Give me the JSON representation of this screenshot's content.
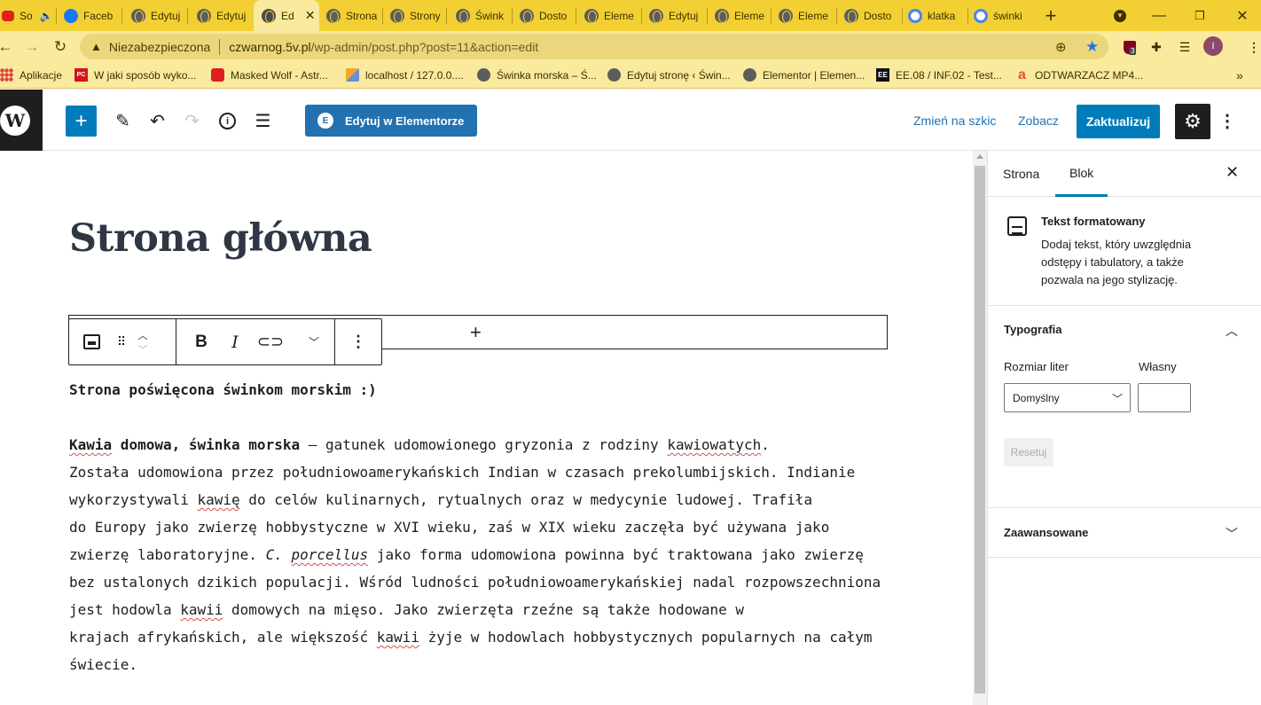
{
  "browser": {
    "tabs": [
      {
        "label": "So",
        "favicon": "youtube-icon"
      },
      {
        "label": "Faceb",
        "favicon": "facebook-icon"
      },
      {
        "label": "Edytuj",
        "favicon": "globe-icon"
      },
      {
        "label": "Edytuj",
        "favicon": "globe-icon"
      },
      {
        "label": "Ed",
        "favicon": "globe-icon",
        "active": true
      },
      {
        "label": "Strona",
        "favicon": "globe-icon"
      },
      {
        "label": "Strony",
        "favicon": "globe-icon"
      },
      {
        "label": "Śwink",
        "favicon": "globe-icon"
      },
      {
        "label": "Dosto",
        "favicon": "globe-icon"
      },
      {
        "label": "Eleme",
        "favicon": "globe-icon"
      },
      {
        "label": "Edytuj",
        "favicon": "globe-icon"
      },
      {
        "label": "Eleme",
        "favicon": "globe-icon"
      },
      {
        "label": "Eleme",
        "favicon": "globe-icon"
      },
      {
        "label": "Dosto",
        "favicon": "globe-icon"
      },
      {
        "label": "klatka",
        "favicon": "google-icon"
      },
      {
        "label": "świnki",
        "favicon": "google-icon"
      }
    ],
    "security_label": "Niezabezpieczona",
    "url_host": "czwarnog.5v.pl",
    "url_path": "/wp-admin/post.php?post=11&action=edit",
    "extension_badge": "3",
    "profile_initial": "I",
    "bookmarks": [
      {
        "label": "Aplikacje",
        "icon": "apps"
      },
      {
        "label": "W jaki sposób wyko...",
        "icon": "pcworld"
      },
      {
        "label": "Masked Wolf - Astr...",
        "icon": "youtube"
      },
      {
        "label": "localhost / 127.0.0....",
        "icon": "phpmyadmin"
      },
      {
        "label": "Świnka morska – Ś...",
        "icon": "globe"
      },
      {
        "label": "Edytuj stronę ‹ Świn...",
        "icon": "globe"
      },
      {
        "label": "Elementor | Elemen...",
        "icon": "globe"
      },
      {
        "label": "EE.08 / INF.02 - Test...",
        "icon": "ee"
      },
      {
        "label": "ODTWARZACZ MP4...",
        "icon": "a"
      }
    ],
    "bookmarks_overflow": "»"
  },
  "wp_toolbar": {
    "elementor_label": "Edytuj w Elementorze",
    "draft_label": "Zmień na szkic",
    "view_label": "Zobacz",
    "update_label": "Zaktualizuj"
  },
  "editor": {
    "title": "Strona główna",
    "intro": "Strona poświęcona świnkom morskim :)",
    "para_runs": [
      {
        "t": "Kawia",
        "c": "strong spell"
      },
      {
        "t": " domowa, świnka morska",
        "c": "strong"
      },
      {
        "t": " – gatunek udomowionego gryzonia z rodziny ",
        "c": ""
      },
      {
        "t": "kawiowatych",
        "c": "spell"
      },
      {
        "t": ".",
        "c": ""
      },
      {
        "t": "\n",
        "c": "br"
      },
      {
        "t": "Została udomowiona przez południowoamerykańskich Indian w czasach prekolumbijskich. Indianie",
        "c": ""
      },
      {
        "t": "\n",
        "c": "br"
      },
      {
        "t": "wykorzystywali ",
        "c": ""
      },
      {
        "t": "kawię",
        "c": "spell"
      },
      {
        "t": " do celów kulinarnych, rytualnych oraz w medycynie ludowej. Trafiła",
        "c": ""
      },
      {
        "t": "\n",
        "c": "br"
      },
      {
        "t": "do Europy jako zwierzę hobbystyczne w XVI wieku, zaś w XIX wieku zaczęła być używana jako",
        "c": ""
      },
      {
        "t": "\n",
        "c": "br"
      },
      {
        "t": "zwierzę laboratoryjne. ",
        "c": ""
      },
      {
        "t": "C. ",
        "c": "italic"
      },
      {
        "t": "porcellus",
        "c": "italic spell"
      },
      {
        "t": " jako forma udomowiona powinna być traktowana jako zwierzę",
        "c": ""
      },
      {
        "t": "\n",
        "c": "br"
      },
      {
        "t": "bez ustalonych dzikich populacji. Wśród ludności południowoamerykańskiej nadal rozpowszechniona",
        "c": ""
      },
      {
        "t": "\n",
        "c": "br"
      },
      {
        "t": "jest hodowla ",
        "c": ""
      },
      {
        "t": "kawii",
        "c": "spell"
      },
      {
        "t": " domowych na mięso. Jako zwierzęta rzeźne są także hodowane w",
        "c": ""
      },
      {
        "t": "\n",
        "c": "br"
      },
      {
        "t": "krajach afrykańskich, ale większość ",
        "c": ""
      },
      {
        "t": "kawii",
        "c": "spell"
      },
      {
        "t": " żyje w hodowlach hobbystycznych popularnych na całym",
        "c": ""
      },
      {
        "t": "\n",
        "c": "br"
      },
      {
        "t": "świecie.",
        "c": ""
      }
    ]
  },
  "sidebar": {
    "tab_page": "Strona",
    "tab_block": "Blok",
    "block_name": "Tekst formatowany",
    "block_desc": "Dodaj tekst, który uwzględnia odstępy i tabulatory, a także pozwala na jego stylizację.",
    "typography": {
      "title": "Typografia",
      "font_size_label": "Rozmiar liter",
      "custom_label": "Własny",
      "select_value": "Domyślny",
      "reset_label": "Resetuj"
    },
    "advanced_title": "Zaawansowane"
  },
  "colors": {
    "tabstrip": "#f2d033",
    "toolbar": "#f9ea9d",
    "wp_blue": "#007cba",
    "elementor_blue": "#2271b1",
    "dark": "#1e1e1e"
  }
}
